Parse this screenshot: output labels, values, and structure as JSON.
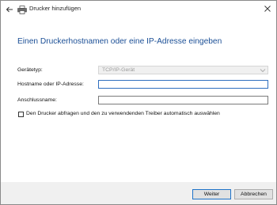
{
  "window": {
    "title": "Drucker hinzufügen"
  },
  "heading": "Einen Druckerhostnamen oder eine IP-Adresse eingeben",
  "form": {
    "device_type": {
      "label": "Gerätetyp:",
      "selected": "TCP/IP-Gerät"
    },
    "hostname": {
      "label": "Hostname oder IP-Adresse:",
      "value": ""
    },
    "port_name": {
      "label": "Anschlussname:",
      "value": ""
    },
    "query_printer": {
      "label": "Den Drucker abfragen und den zu verwendenden Treiber automatisch auswählen",
      "checked": false
    }
  },
  "buttons": {
    "next": "Weiter",
    "cancel": "Abbrechen"
  }
}
